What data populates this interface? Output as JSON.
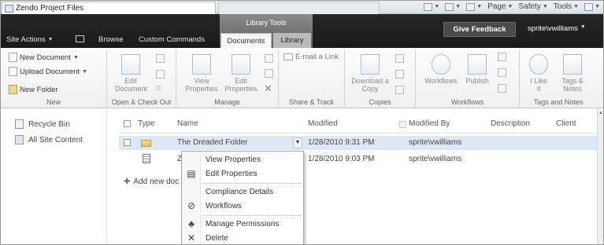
{
  "browser": {
    "tab_title": "Zendo Project Files",
    "commands": [
      {
        "label": "Page",
        "icon": "page-icon"
      },
      {
        "label": "Safety",
        "icon": "safety-icon"
      },
      {
        "label": "Tools",
        "icon": "tools-icon"
      }
    ]
  },
  "ribbon_header": {
    "site_actions": "Site Actions",
    "browse": "Browse",
    "custom_commands": "Custom Commands",
    "context_group": "Library Tools",
    "tab_documents": "Documents",
    "tab_library": "Library",
    "give_feedback": "Give Feedback",
    "user": "sprite\\vwilliams"
  },
  "ribbon": {
    "new_group": {
      "new_document": "New Document",
      "upload_document": "Upload Document",
      "new_folder": "New Folder",
      "label": "New"
    },
    "open_checkout": {
      "edit_document_1": "Edit",
      "edit_document_2": "Document",
      "label": "Open & Check Out"
    },
    "manage": {
      "view_1": "View",
      "view_2": "Properties",
      "edit_1": "Edit",
      "edit_2": "Properties",
      "label": "Manage"
    },
    "share_track": {
      "email_link": "E-mail a Link",
      "label": "Share & Track"
    },
    "copies": {
      "download_1": "Download a",
      "download_2": "Copy",
      "label": "Copies"
    },
    "workflows": {
      "workflows": "Workflows",
      "publish": "Publish",
      "label": "Workflows"
    },
    "tags_notes": {
      "ilike_1": "I Like",
      "ilike_2": "It",
      "tags_1": "Tags &",
      "tags_2": "Notes",
      "label": "Tags and Notes"
    }
  },
  "leftnav": {
    "recycle_bin": "Recycle Bin",
    "all_site_content": "All Site Content"
  },
  "list": {
    "columns": {
      "type": "Type",
      "name": "Name",
      "modified": "Modified",
      "modified_by": "Modified By",
      "description": "Description",
      "client": "Client"
    },
    "rows": [
      {
        "name": "The Dreaded Folder",
        "modified": "1/28/2010 9:31 PM",
        "modified_by": "sprite\\vwilliams"
      },
      {
        "name": "Z",
        "modified": "1/28/2010 9:03 PM",
        "modified_by": "sprite\\vwilliams"
      }
    ],
    "add_new": "Add new doc"
  },
  "context_menu": {
    "view_properties": "View Properties",
    "edit_properties": "Edit Properties",
    "compliance_details": "Compliance Details",
    "workflows": "Workflows",
    "manage_permissions": "Manage Permissions",
    "delete": "Delete"
  }
}
